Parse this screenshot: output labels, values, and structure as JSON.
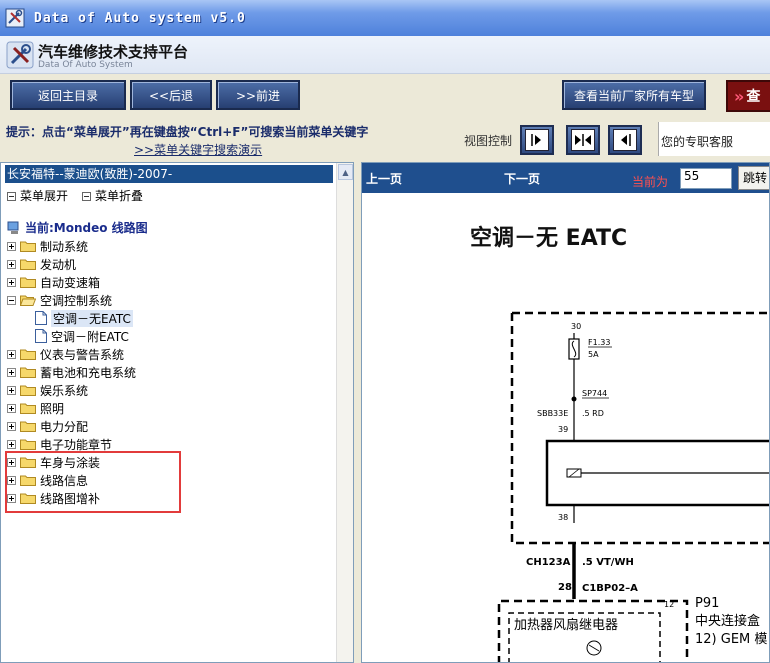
{
  "window": {
    "title": "Data of Auto system v5.0"
  },
  "brand": {
    "title_cn": "汽车维修技术支持平台",
    "title_en": "Data Of Auto System"
  },
  "nav": {
    "home": "返回主目录",
    "back": "<<后退",
    "forward": ">>前进",
    "all_models": "查看当前厂家所有车型",
    "search": "查"
  },
  "hint": {
    "line1": "提示：点击“菜单展开”再在键盘按“Ctrl+F”可搜索当前菜单关键字",
    "line2": ">>菜单关键字搜索演示"
  },
  "view_control": {
    "label": "视图控制"
  },
  "service": {
    "label": "您的专职客服"
  },
  "left": {
    "vehicle": "长安福特--蒙迪欧(致胜)-2007-",
    "expand": "菜单展开",
    "collapse": "菜单折叠",
    "current": "当前:Mondeo 线路图",
    "tree": [
      {
        "label": "制动系统"
      },
      {
        "label": "发动机"
      },
      {
        "label": "自动变速箱"
      },
      {
        "label": "空调控制系统"
      },
      {
        "label": "空调－无EATC"
      },
      {
        "label": "空调－附EATC"
      },
      {
        "label": "仪表与警告系统"
      },
      {
        "label": "蓄电池和充电系统"
      },
      {
        "label": "娱乐系统"
      },
      {
        "label": "照明"
      },
      {
        "label": "电力分配"
      },
      {
        "label": "电子功能章节"
      },
      {
        "label": "车身与涂装"
      },
      {
        "label": "线路信息"
      },
      {
        "label": "线路图增补"
      }
    ]
  },
  "right": {
    "prev": "上一页",
    "next": "下一页",
    "current_label": "当前为",
    "current_page": "55",
    "jump": "跳转",
    "diagram": {
      "title": "空调－无 EATC",
      "pin30": "30",
      "fuse": "F1.33",
      "fuse_rating": "5A",
      "splice": "SP744",
      "circuit1": "SBB33E",
      "wire1": ".5 RD",
      "pin39": "39",
      "pin38": "38",
      "circuit2": "CH123A",
      "wire2": ".5 VT/WH",
      "pin28": "28",
      "connector": "C1BP02–A",
      "pin12": "12",
      "relay": "加热器风扇继电器",
      "module_id": "P91",
      "module_cn": "中央连接盒",
      "module_sub": "12) GEM 模"
    }
  },
  "colors": {
    "accent": "#1f4f8e",
    "highlight": "#e23b3b"
  }
}
